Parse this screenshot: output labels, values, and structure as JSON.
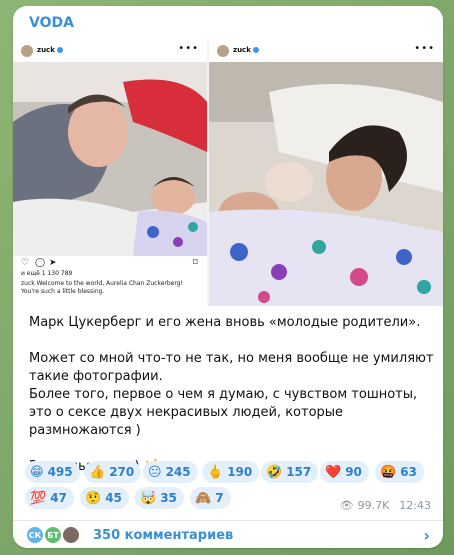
{
  "channel": {
    "name": "VODA"
  },
  "posts": {
    "left": {
      "user": "zuck",
      "likes_text": "и ещё 1 130 789",
      "caption": "zuck Welcome to the world, Aurelia Chan Zuckerberg! You're such a little blessing."
    },
    "right": {
      "user": "zuck"
    }
  },
  "message": {
    "p1": "Марк Цукерберг и его жена вновь «молодые родители».",
    "p2": "Может со мной что-то не так, но меня вообще не умиляют такие фотографии.",
    "p3": "Более того, первое о чем я думаю, с чувством тошноты, это о сексе двух некрасивых людей, которые размножаются )",
    "p4": "Здоровья всем ) 🤘"
  },
  "reactions": [
    {
      "emoji": "😁",
      "count": "495"
    },
    {
      "emoji": "👍",
      "count": "270"
    },
    {
      "emoji": "😐",
      "count": "245"
    },
    {
      "emoji": "🖕",
      "count": "190"
    },
    {
      "emoji": "🤣",
      "count": "157"
    },
    {
      "emoji": "❤️",
      "count": "90"
    },
    {
      "emoji": "🤬",
      "count": "63"
    },
    {
      "emoji": "💯",
      "count": "47"
    },
    {
      "emoji": "🤨",
      "count": "45"
    },
    {
      "emoji": "🤯",
      "count": "35"
    },
    {
      "emoji": "🙈",
      "count": "7"
    }
  ],
  "meta": {
    "views": "99.7K",
    "time": "12:43"
  },
  "comments": {
    "label": "350 комментариев",
    "avatars": [
      {
        "initials": "СК",
        "color": "#5fb3e8"
      },
      {
        "initials": "БТ",
        "color": "#5cc16e"
      }
    ]
  }
}
